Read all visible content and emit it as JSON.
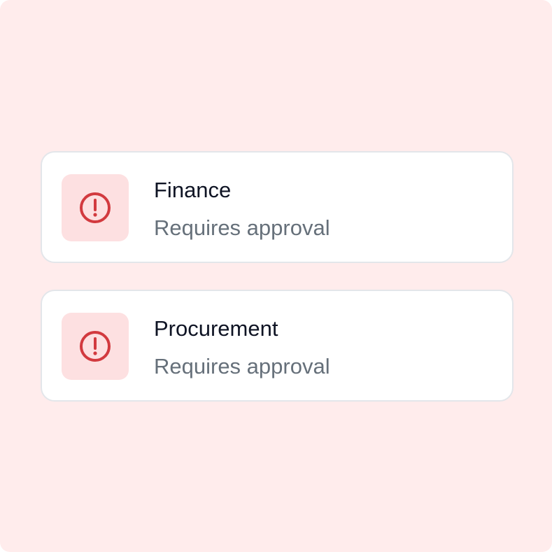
{
  "colors": {
    "background": "#ffecec",
    "card_background": "#ffffff",
    "card_border": "#e3e6ea",
    "icon_tile": "#fde0e1",
    "icon_stroke": "#d23a3f",
    "title_text": "#0f1424",
    "subtitle_text": "#66707a"
  },
  "approvals": [
    {
      "icon": "alert-circle-icon",
      "title": "Finance",
      "status": "Requires approval"
    },
    {
      "icon": "alert-circle-icon",
      "title": "Procurement",
      "status": "Requires approval"
    }
  ]
}
